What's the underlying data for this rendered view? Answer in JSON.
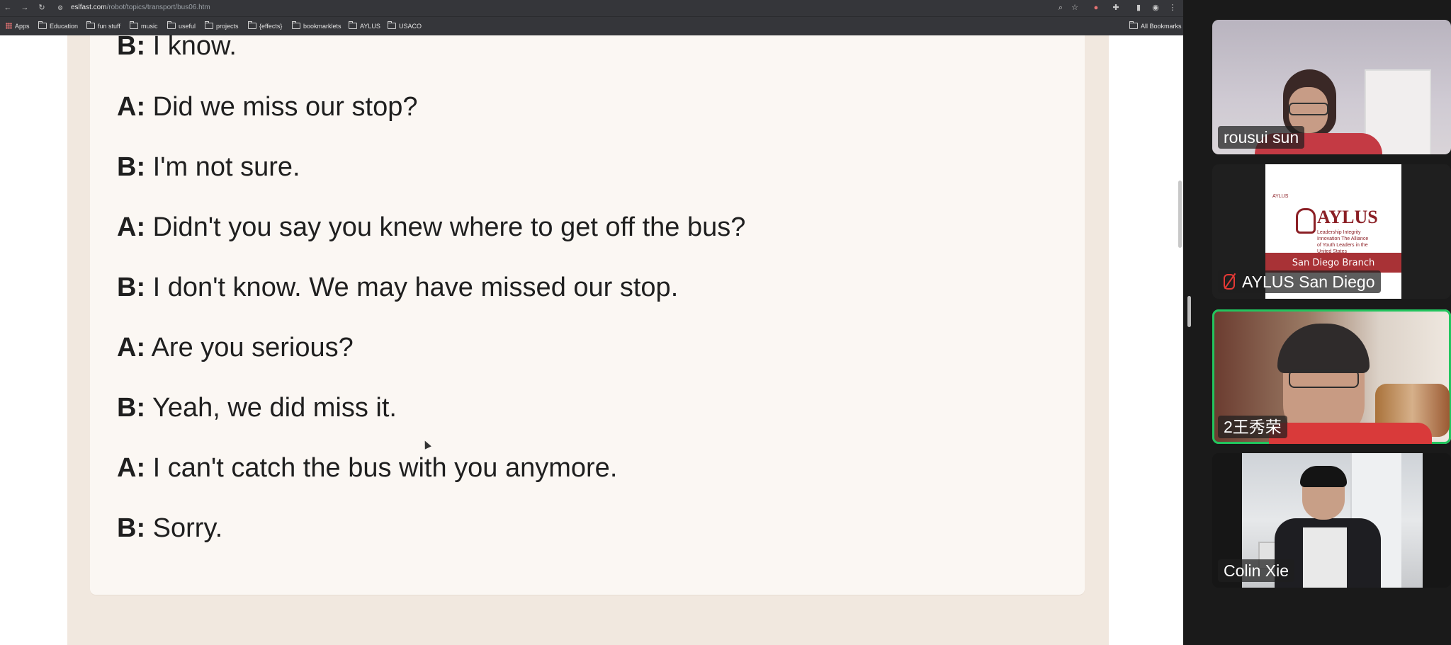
{
  "browser": {
    "url_host": "eslfast.com",
    "url_path": "/robot/topics/transport/bus06.htm",
    "bookmarks": [
      "Apps",
      "Education",
      "fun stuff",
      "music",
      "useful",
      "projects",
      "{effects}",
      "bookmarklets",
      "AYLUS",
      "USACO"
    ],
    "all_bookmarks": "All Bookmarks"
  },
  "dialogue": [
    {
      "speaker": "B:",
      "text": "I know."
    },
    {
      "speaker": "A:",
      "text": "Did we miss our stop?"
    },
    {
      "speaker": "B:",
      "text": "I'm not sure."
    },
    {
      "speaker": "A:",
      "text": "Didn't you say you knew where to get off the bus?"
    },
    {
      "speaker": "B:",
      "text": "I don't know. We may have missed our stop."
    },
    {
      "speaker": "A:",
      "text": "Are you serious?"
    },
    {
      "speaker": "B:",
      "text": "Yeah, we did miss it."
    },
    {
      "speaker": "A:",
      "text": "I can't catch the bus with you anymore."
    },
    {
      "speaker": "B:",
      "text": "Sorry."
    }
  ],
  "participants": [
    {
      "name": "rousui sun",
      "muted": false,
      "active": false
    },
    {
      "name": "AYLUS San Diego",
      "muted": true,
      "active": false
    },
    {
      "name": "2王秀荣",
      "muted": false,
      "active": true
    },
    {
      "name": "Colin Xie",
      "muted": false,
      "active": false
    }
  ],
  "aylus_card": {
    "small": "AYLUS",
    "brand": "AYLUS",
    "tagline": "Leadership Integrity Innovation The Alliance of Youth Leaders in the United States www.aylus.org",
    "branch": "San Diego Branch"
  },
  "icons": [
    "back-arrow-icon",
    "forward-arrow-icon",
    "reload-icon",
    "zoom-icon",
    "star-icon",
    "extension-icon",
    "sidebar-icon",
    "profile-icon",
    "menu-dots-icon",
    "apps-grid-icon",
    "folder-icon",
    "mic-muted-icon"
  ],
  "colors": {
    "active_speaker": "#22c55e",
    "muted": "#e53935",
    "page_outer": "#f1e8df",
    "page_inner": "#fbf7f3"
  }
}
